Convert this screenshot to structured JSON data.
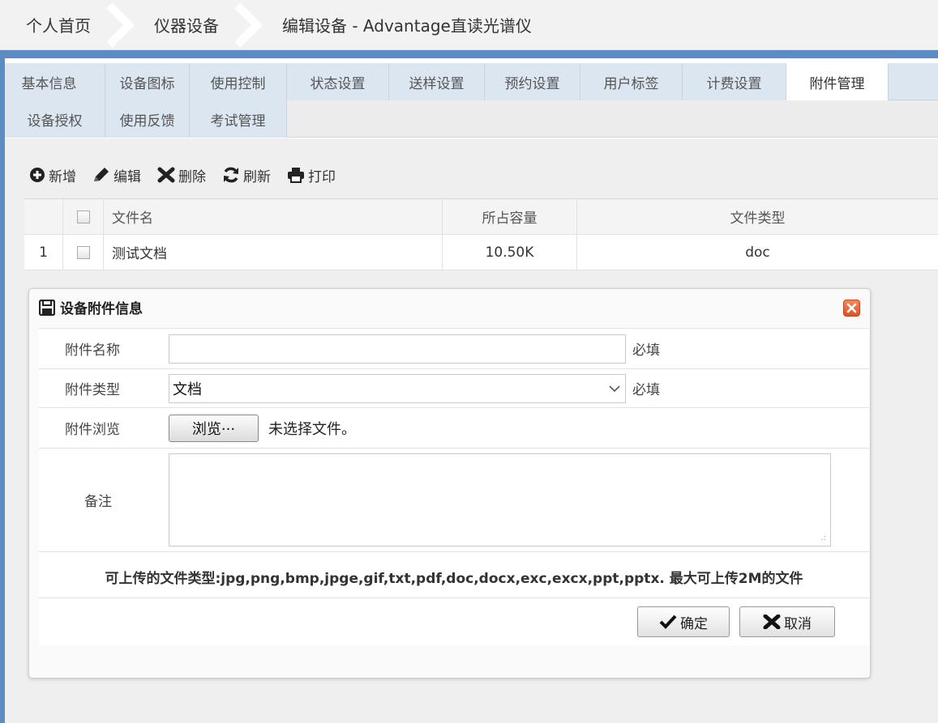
{
  "breadcrumb": [
    "个人首页",
    "仪器设备",
    "编辑设备 - Advantage直读光谱仪"
  ],
  "tabs_row1": [
    "基本信息",
    "设备图标",
    "使用控制",
    "状态设置",
    "送样设置",
    "预约设置",
    "用户标签",
    "计费设置",
    "附件管理"
  ],
  "tabs_row2": [
    "设备授权",
    "使用反馈",
    "考试管理"
  ],
  "active_tab": "附件管理",
  "toolbar": {
    "add": "新增",
    "edit": "编辑",
    "delete": "删除",
    "refresh": "刷新",
    "print": "打印"
  },
  "grid": {
    "columns": [
      "文件名",
      "所占容量",
      "文件类型"
    ],
    "rows": [
      {
        "num": "1",
        "name": "测试文档",
        "size": "10.50K",
        "type": "doc"
      }
    ]
  },
  "dialog": {
    "title": "设备附件信息",
    "name_label": "附件名称",
    "name_value": "",
    "type_label": "附件类型",
    "type_value": "文档",
    "browse_label": "附件浏览",
    "browse_button": "浏览···",
    "no_file": "未选择文件。",
    "note_label": "备注",
    "required": "必填",
    "hint": "可上传的文件类型:jpg,png,bmp,jpge,gif,txt,pdf,doc,docx,exc,excx,ppt,pptx. 最大可上传2M的文件",
    "ok": "确定",
    "cancel": "取消"
  },
  "colors": {
    "accent": "#5b8dc4",
    "tab_bg": "#dce6f1",
    "close": "#d9532c"
  }
}
